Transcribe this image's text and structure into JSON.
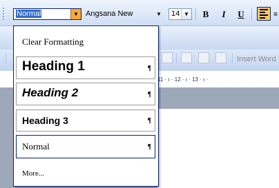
{
  "toolbar": {
    "style_value": "Normal",
    "font_value": "Angsana New",
    "size_value": "14",
    "bold_label": "B",
    "italic_label": "I",
    "underline_label": "U"
  },
  "toolbar2": {
    "insert_word_label": "Insert Word"
  },
  "ruler": {
    "ticks_text": "11 · ı · 12 · ı · 13 · ı ·"
  },
  "style_menu": {
    "clear_label": "Clear Formatting",
    "items": [
      {
        "label": "Heading 1",
        "mark": "¶"
      },
      {
        "label": "Heading 2",
        "mark": "¶"
      },
      {
        "label": "Heading 3",
        "mark": "¶"
      },
      {
        "label": "Normal",
        "mark": "¶"
      }
    ],
    "more_label": "More..."
  },
  "icons": {
    "dropdown": "chevron-down-icon",
    "pilcrow": "paragraph-mark-icon",
    "align": "align-left-icon"
  },
  "colors": {
    "toolbar_top": "#eef4fd",
    "toolbar_bottom": "#cfdef5",
    "selection": "#316ac5",
    "active_dropdown": "#f6a93b",
    "highlight_button": "#ffc864"
  }
}
